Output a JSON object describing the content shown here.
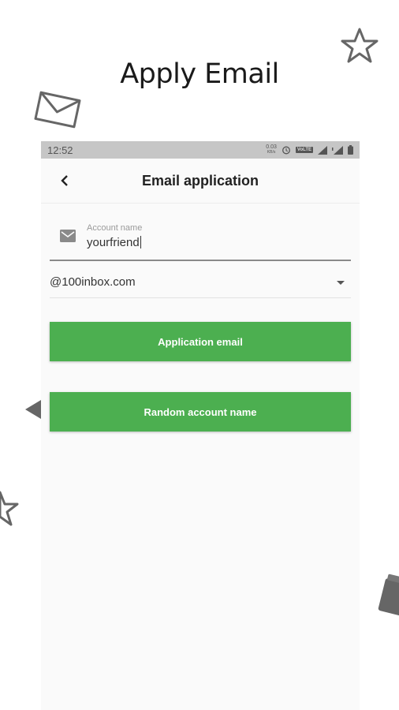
{
  "promo": {
    "title": "Apply Email"
  },
  "status_bar": {
    "time": "12:52",
    "net_speed_value": "0.03",
    "net_speed_unit": "KB/s",
    "volte": "VoLTE"
  },
  "app_bar": {
    "title": "Email application"
  },
  "form": {
    "account_label": "Account name",
    "account_value": "yourfriend",
    "domain_value": "@100inbox.com"
  },
  "buttons": {
    "apply": "Application email",
    "random": "Random account name"
  },
  "colors": {
    "accent": "#4caf50",
    "status_bar": "#c6c6c6",
    "background": "#fafafa"
  }
}
